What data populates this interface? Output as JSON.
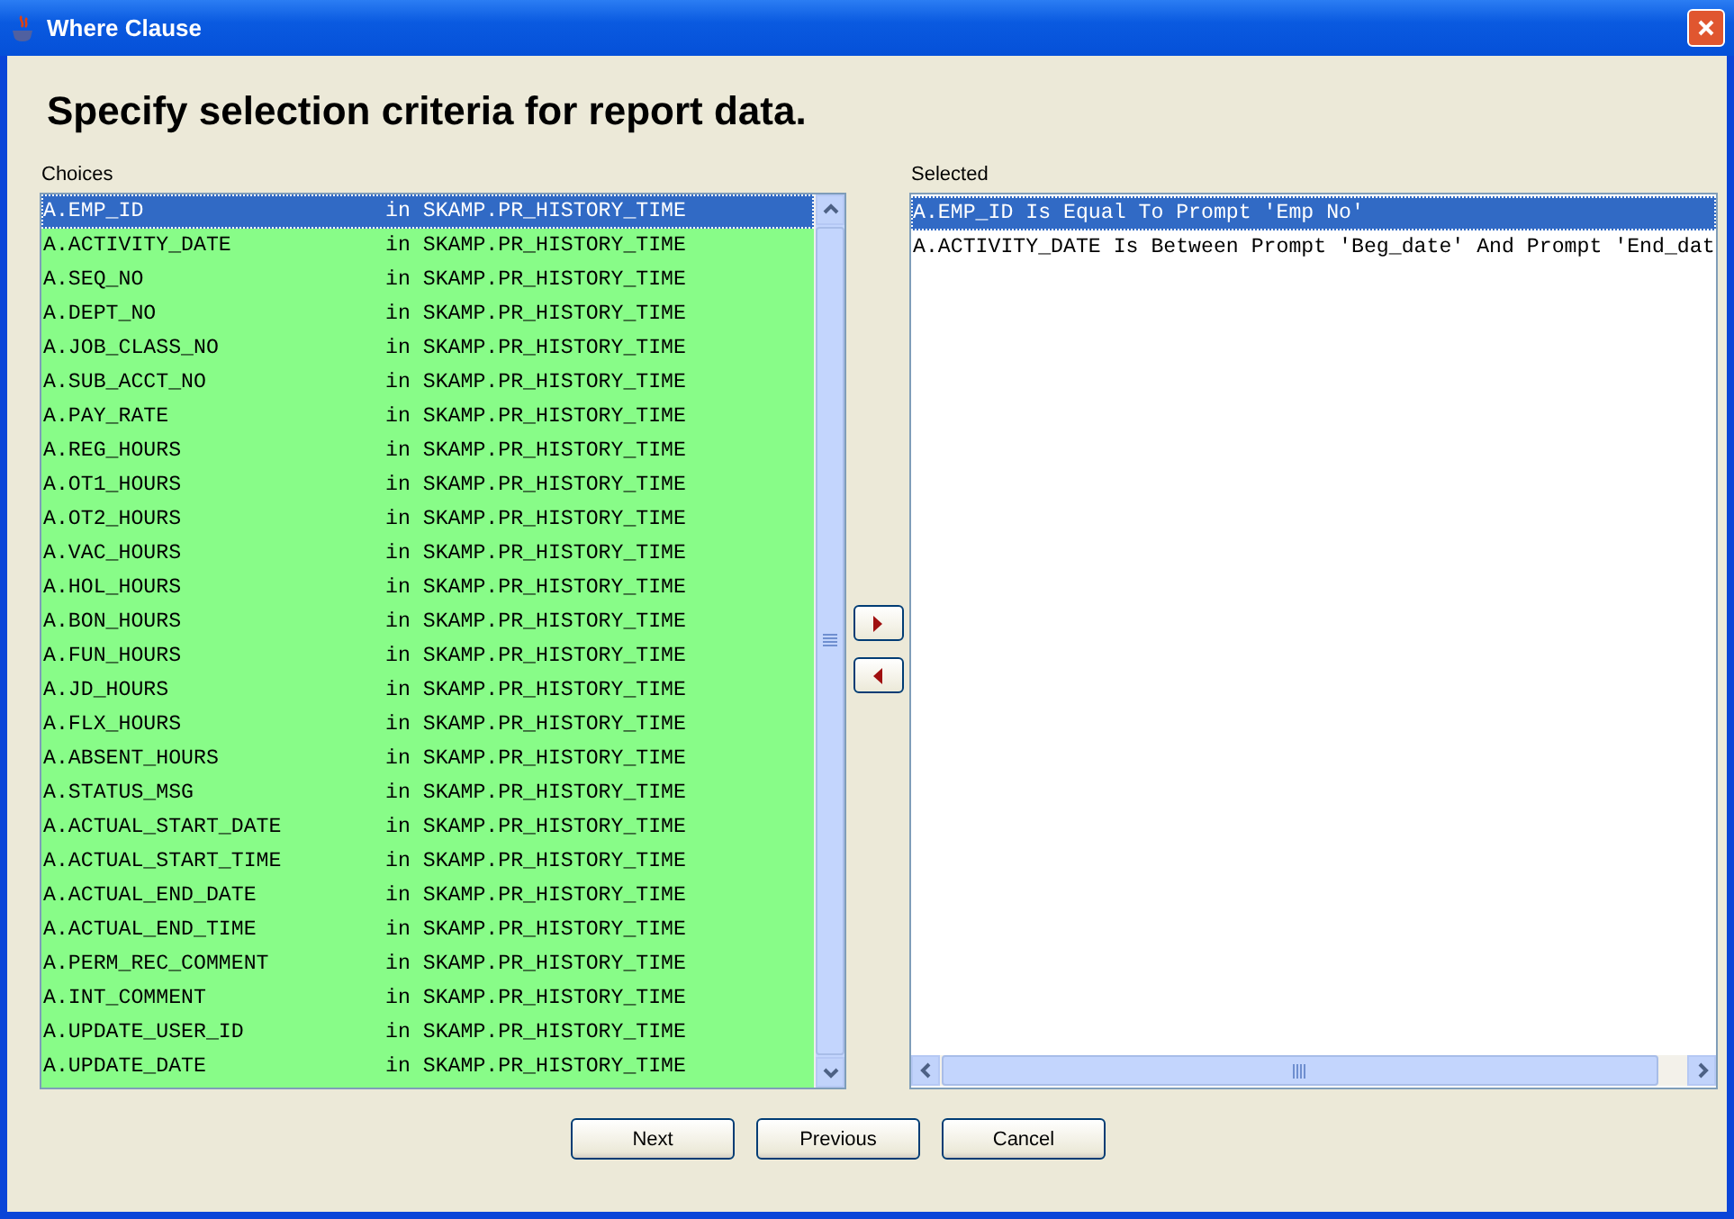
{
  "window": {
    "title": "Where Clause"
  },
  "heading": "Specify selection criteria for report data.",
  "choices": {
    "label": "Choices",
    "rows": [
      {
        "field": "A.EMP_ID",
        "source": "in SKAMP.PR_HISTORY_TIME",
        "selected": true
      },
      {
        "field": "A.ACTIVITY_DATE",
        "source": "in SKAMP.PR_HISTORY_TIME",
        "selected": false
      },
      {
        "field": "A.SEQ_NO",
        "source": "in SKAMP.PR_HISTORY_TIME",
        "selected": false
      },
      {
        "field": "A.DEPT_NO",
        "source": "in SKAMP.PR_HISTORY_TIME",
        "selected": false
      },
      {
        "field": "A.JOB_CLASS_NO",
        "source": "in SKAMP.PR_HISTORY_TIME",
        "selected": false
      },
      {
        "field": "A.SUB_ACCT_NO",
        "source": "in SKAMP.PR_HISTORY_TIME",
        "selected": false
      },
      {
        "field": "A.PAY_RATE",
        "source": "in SKAMP.PR_HISTORY_TIME",
        "selected": false
      },
      {
        "field": "A.REG_HOURS",
        "source": "in SKAMP.PR_HISTORY_TIME",
        "selected": false
      },
      {
        "field": "A.OT1_HOURS",
        "source": "in SKAMP.PR_HISTORY_TIME",
        "selected": false
      },
      {
        "field": "A.OT2_HOURS",
        "source": "in SKAMP.PR_HISTORY_TIME",
        "selected": false
      },
      {
        "field": "A.VAC_HOURS",
        "source": "in SKAMP.PR_HISTORY_TIME",
        "selected": false
      },
      {
        "field": "A.HOL_HOURS",
        "source": "in SKAMP.PR_HISTORY_TIME",
        "selected": false
      },
      {
        "field": "A.BON_HOURS",
        "source": "in SKAMP.PR_HISTORY_TIME",
        "selected": false
      },
      {
        "field": "A.FUN_HOURS",
        "source": "in SKAMP.PR_HISTORY_TIME",
        "selected": false
      },
      {
        "field": "A.JD_HOURS",
        "source": "in SKAMP.PR_HISTORY_TIME",
        "selected": false
      },
      {
        "field": "A.FLX_HOURS",
        "source": "in SKAMP.PR_HISTORY_TIME",
        "selected": false
      },
      {
        "field": "A.ABSENT_HOURS",
        "source": "in SKAMP.PR_HISTORY_TIME",
        "selected": false
      },
      {
        "field": "A.STATUS_MSG",
        "source": "in SKAMP.PR_HISTORY_TIME",
        "selected": false
      },
      {
        "field": "A.ACTUAL_START_DATE",
        "source": "in SKAMP.PR_HISTORY_TIME",
        "selected": false
      },
      {
        "field": "A.ACTUAL_START_TIME",
        "source": "in SKAMP.PR_HISTORY_TIME",
        "selected": false
      },
      {
        "field": "A.ACTUAL_END_DATE",
        "source": "in SKAMP.PR_HISTORY_TIME",
        "selected": false
      },
      {
        "field": "A.ACTUAL_END_TIME",
        "source": "in SKAMP.PR_HISTORY_TIME",
        "selected": false
      },
      {
        "field": "A.PERM_REC_COMMENT",
        "source": "in SKAMP.PR_HISTORY_TIME",
        "selected": false
      },
      {
        "field": "A.INT_COMMENT",
        "source": "in SKAMP.PR_HISTORY_TIME",
        "selected": false
      },
      {
        "field": "A.UPDATE_USER_ID",
        "source": "in SKAMP.PR_HISTORY_TIME",
        "selected": false
      },
      {
        "field": "A.UPDATE_DATE",
        "source": "in SKAMP.PR_HISTORY_TIME",
        "selected": false
      }
    ]
  },
  "selected": {
    "label": "Selected",
    "rows": [
      {
        "text": "A.EMP_ID Is Equal To Prompt 'Emp No'",
        "selected": true
      },
      {
        "text": "A.ACTIVITY_DATE Is Between Prompt 'Beg_date' And Prompt 'End_dat",
        "selected": false
      }
    ]
  },
  "buttons": [
    "Next",
    "Previous",
    "Cancel"
  ]
}
